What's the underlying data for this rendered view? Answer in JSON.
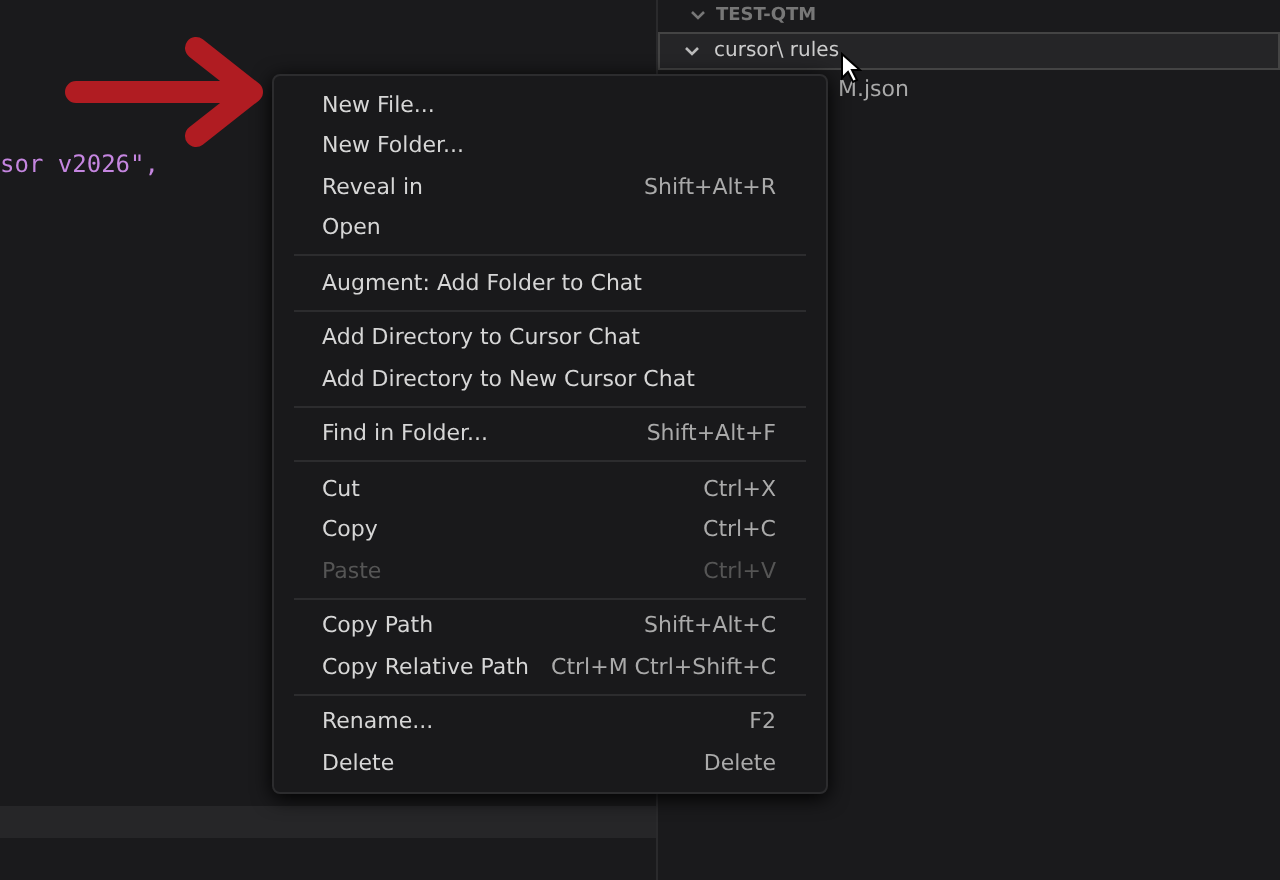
{
  "editor": {
    "code_line": "sor v2026\","
  },
  "explorer": {
    "section": "TEST-QTM",
    "folder": {
      "label": "cursor\\ rules",
      "expanded": true,
      "selected": true
    },
    "file": "M.json"
  },
  "menu": {
    "groups": [
      {
        "items": [
          {
            "label": "New File...",
            "disabled": false
          },
          {
            "label": "New Folder...",
            "disabled": false
          },
          {
            "label": "Reveal in",
            "shortcut": "Shift+Alt+R",
            "disabled": false
          },
          {
            "label": "Open",
            "disabled": false
          }
        ]
      },
      {
        "items": [
          {
            "label": "Augment: Add Folder to Chat",
            "disabled": false
          }
        ]
      },
      {
        "items": [
          {
            "label": "Add Directory to Cursor Chat",
            "disabled": false
          },
          {
            "label": "Add Directory to New Cursor Chat",
            "disabled": false
          }
        ]
      },
      {
        "items": [
          {
            "label": "Find in Folder...",
            "shortcut": "Shift+Alt+F",
            "disabled": false
          }
        ]
      },
      {
        "items": [
          {
            "label": "Cut",
            "shortcut": "Ctrl+X",
            "disabled": false
          },
          {
            "label": "Copy",
            "shortcut": "Ctrl+C",
            "disabled": false
          },
          {
            "label": "Paste",
            "shortcut": "Ctrl+V",
            "disabled": true
          }
        ]
      },
      {
        "items": [
          {
            "label": "Copy Path",
            "shortcut": "Shift+Alt+C",
            "disabled": false
          },
          {
            "label": "Copy Relative Path",
            "shortcut": "Ctrl+M Ctrl+Shift+C",
            "disabled": false
          }
        ]
      },
      {
        "items": [
          {
            "label": "Rename...",
            "shortcut": "F2",
            "disabled": false
          },
          {
            "label": "Delete",
            "shortcut": "Delete",
            "disabled": false
          }
        ]
      }
    ]
  }
}
